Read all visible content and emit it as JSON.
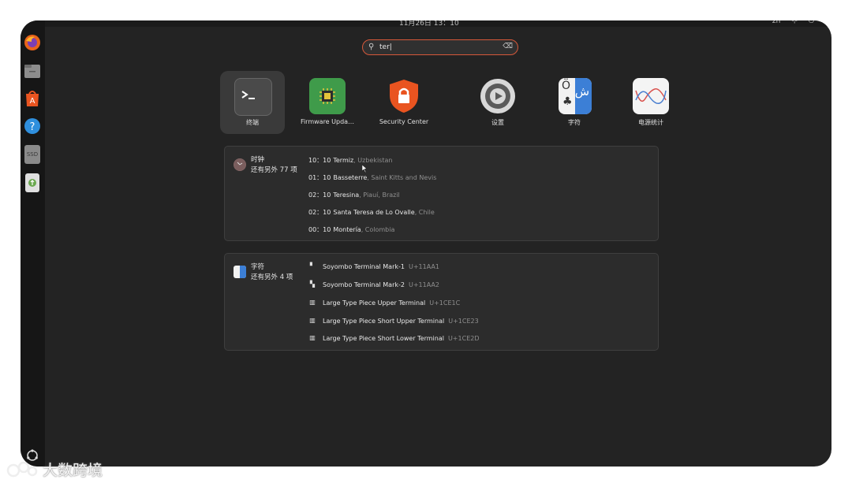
{
  "topbar": {
    "clock": "11月26日 13：10",
    "lang": "zh"
  },
  "search": {
    "value": "ter|",
    "placeholder": ""
  },
  "dock": {
    "items": [
      {
        "name": "firefox",
        "color": "#e8641b"
      },
      {
        "name": "files",
        "color": "#9a9a9a"
      },
      {
        "name": "app-center",
        "color": "#e95420"
      },
      {
        "name": "help",
        "color": "#2f8fdd"
      },
      {
        "name": "ssd",
        "label": "SSD",
        "color": "#7a7a7a"
      },
      {
        "name": "trash",
        "color": "#6aa84f"
      }
    ]
  },
  "apps": [
    {
      "label": "终端",
      "icon": "terminal-icon",
      "selected": true
    },
    {
      "label": "Firmware Upda…",
      "icon": "chip-icon"
    },
    {
      "label": "Security Center",
      "icon": "lock-shield-icon"
    },
    {
      "label": "设置",
      "icon": "gear-icon"
    },
    {
      "label": "字符",
      "icon": "characters-icon",
      "glyph_left": "Ö",
      "glyph_right": "ش"
    },
    {
      "label": "电源统计",
      "icon": "power-graph-icon"
    }
  ],
  "clock_panel": {
    "title": "时钟",
    "subtitle": "还有另外 77 项",
    "rows": [
      {
        "time": "10：10",
        "city": "Termiz",
        "country": ", Uzbekistan"
      },
      {
        "time": "01：10",
        "city": "Basseterre",
        "country": ", Saint Kitts and Nevis"
      },
      {
        "time": "02：10",
        "city": "Teresina",
        "country": ", Piauí, Brazil"
      },
      {
        "time": "02：10",
        "city": "Santa Teresa de Lo Ovalle",
        "country": ", Chile"
      },
      {
        "time": "00：10",
        "city": "Montería",
        "country": ", Colombia"
      }
    ]
  },
  "chars_panel": {
    "title": "字符",
    "subtitle": "还有另外 4 项",
    "rows": [
      {
        "glyph": "▘",
        "name": "Soyombo Terminal Mark-1",
        "code": "U+11AA1"
      },
      {
        "glyph": "▚",
        "name": "Soyombo Terminal Mark-2",
        "code": "U+11AA2"
      },
      {
        "glyph": "▥",
        "name": "Large Type Piece Upper Terminal",
        "code": "U+1CE1C"
      },
      {
        "glyph": "▥",
        "name": "Large Type Piece Short Upper Terminal",
        "code": "U+1CE23"
      },
      {
        "glyph": "▥",
        "name": "Large Type Piece Short Lower Terminal",
        "code": "U+1CE2D"
      }
    ]
  },
  "watermark": {
    "text": "大数跨境"
  }
}
